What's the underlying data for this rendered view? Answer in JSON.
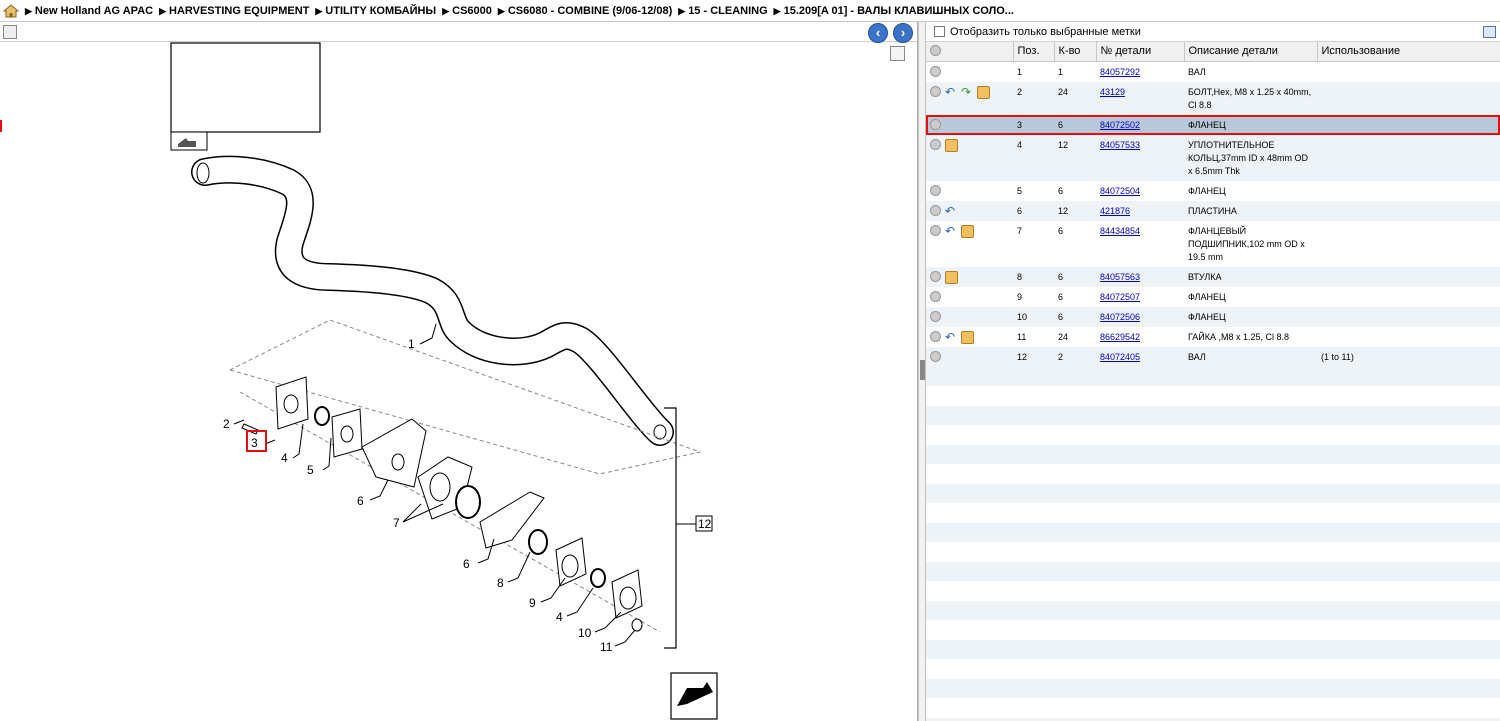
{
  "breadcrumb": [
    "New Holland AG APAC",
    "HARVESTING EQUIPMENT",
    "UTILITY КОМБАЙНЫ",
    "CS6000",
    "CS6080 - COMBINE (9/06-12/08)",
    "15 - CLEANING",
    "15.209[A 01] - ВАЛЫ КЛАВИШНЫХ СОЛО..."
  ],
  "filter": {
    "label": "Отобразить только выбранные метки"
  },
  "table": {
    "headers": [
      "Поз.",
      "К-во",
      "№ детали",
      "Описание детали",
      "Использование"
    ],
    "rows": [
      {
        "pos": "1",
        "qty": "1",
        "part": "84057292",
        "desc": "ВАЛ",
        "usage": "",
        "icons": []
      },
      {
        "pos": "2",
        "qty": "24",
        "part": "43129",
        "desc": "БОЛТ,Hex, M8 x 1.25 x 40mm, Cl 8.8",
        "usage": "",
        "icons": [
          "back-arrow-icon",
          "forward-arrow-icon",
          "box-icon"
        ]
      },
      {
        "pos": "3",
        "qty": "6",
        "part": "84072502",
        "desc": "ФЛАНЕЦ",
        "usage": "",
        "icons": [],
        "selected": true
      },
      {
        "pos": "4",
        "qty": "12",
        "part": "84057533",
        "desc": "УПЛОТНИТЕЛЬНОЕ КОЛЬЦ,37mm ID x 48mm OD x 6.5mm Thk",
        "usage": "",
        "icons": [
          "box-icon"
        ]
      },
      {
        "pos": "5",
        "qty": "6",
        "part": "84072504",
        "desc": "ФЛАНЕЦ",
        "usage": "",
        "icons": []
      },
      {
        "pos": "6",
        "qty": "12",
        "part": "421876",
        "desc": "ПЛАСТИНА",
        "usage": "",
        "icons": [
          "back-arrow-icon"
        ]
      },
      {
        "pos": "7",
        "qty": "6",
        "part": "84434854",
        "desc": "ФЛАНЦЕВЫЙ ПОДШИПНИК,102 mm OD x 19.5 mm",
        "usage": "",
        "icons": [
          "back-arrow-icon",
          "box-icon"
        ]
      },
      {
        "pos": "8",
        "qty": "6",
        "part": "84057563",
        "desc": "ВТУЛКА",
        "usage": "",
        "icons": [
          "box-icon"
        ]
      },
      {
        "pos": "9",
        "qty": "6",
        "part": "84072507",
        "desc": "ФЛАНЕЦ",
        "usage": "",
        "icons": []
      },
      {
        "pos": "10",
        "qty": "6",
        "part": "84072506",
        "desc": "ФЛАНЕЦ",
        "usage": "",
        "icons": []
      },
      {
        "pos": "11",
        "qty": "24",
        "part": "86629542",
        "desc": "ГАЙКА ,M8 x 1.25, Cl 8.8",
        "usage": "",
        "icons": [
          "back-arrow-icon",
          "box-icon"
        ]
      },
      {
        "pos": "12",
        "qty": "2",
        "part": "84072405",
        "desc": "ВАЛ",
        "usage": "(1 to 11)",
        "icons": []
      }
    ]
  },
  "diagram": {
    "callouts": [
      "1",
      "2",
      "3",
      "4",
      "5",
      "6",
      "7",
      "6",
      "8",
      "9",
      "4",
      "10",
      "11",
      "12"
    ]
  }
}
